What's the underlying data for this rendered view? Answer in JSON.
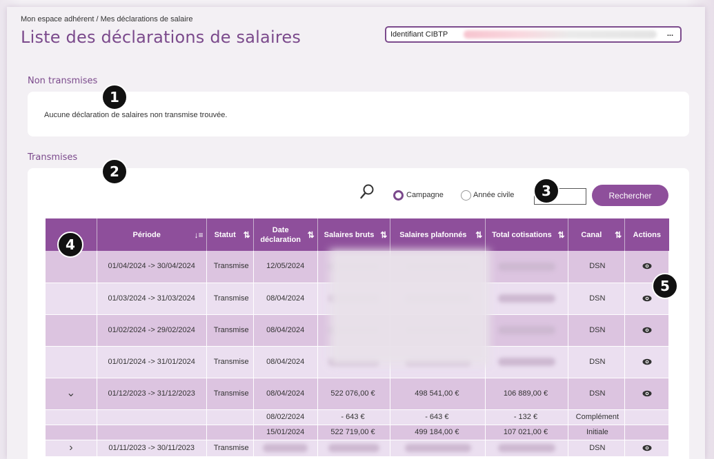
{
  "breadcrumb": "Mon espace adhérent / Mes déclarations de salaire",
  "page_title": "Liste des déclarations de salaires",
  "ident": {
    "label": "Identifiant CIBTP",
    "more": "..."
  },
  "non_transmises": {
    "label": "Non transmises",
    "empty_text": "Aucune déclaration de salaires non transmise trouvée."
  },
  "transmises": {
    "label": "Transmises"
  },
  "search": {
    "radio_campagne": "Campagne",
    "radio_annee": "Année civile",
    "selected": "Campagne",
    "input_value": "",
    "button": "Rechercher"
  },
  "badges": [
    "1",
    "2",
    "3",
    "4",
    "5"
  ],
  "table": {
    "headers": {
      "periode": "Période",
      "statut": "Statut",
      "date_declaration": "Date déclaration",
      "salaires_bruts": "Salaires bruts",
      "salaires_plafonnes": "Salaires plafonnés",
      "total_cotisations": "Total cotisations",
      "canal": "Canal",
      "actions": "Actions"
    },
    "rows": [
      {
        "periode": "01/04/2024 -> 30/04/2024",
        "statut": "Transmise",
        "date": "12/05/2024",
        "canal": "DSN"
      },
      {
        "periode": "01/03/2024 -> 31/03/2024",
        "statut": "Transmise",
        "date": "08/04/2024",
        "canal": "DSN"
      },
      {
        "periode": "01/02/2024 -> 29/02/2024",
        "statut": "Transmise",
        "date": "08/04/2024",
        "canal": "DSN"
      },
      {
        "periode": "01/01/2024 -> 31/01/2024",
        "statut": "Transmise",
        "date": "08/04/2024",
        "canal": "DSN"
      },
      {
        "periode": "01/12/2023 -> 31/12/2023",
        "statut": "Transmise",
        "date": "08/04/2024",
        "bruts": "522 076,00 €",
        "plafonnes": "498 541,00 €",
        "cotisations": "106 889,00 €",
        "canal": "DSN"
      }
    ],
    "sub_rows": [
      {
        "date": "08/02/2024",
        "bruts": "- 643 €",
        "plafonnes": "- 643 €",
        "cotisations": "- 132 €",
        "canal": "Complément"
      },
      {
        "date": "15/01/2024",
        "bruts": "522 719,00 €",
        "plafonnes": "499 184,00 €",
        "cotisations": "107 021,00 €",
        "canal": "Initiale"
      }
    ],
    "last_row": {
      "periode": "01/11/2023 -> 30/11/2023",
      "statut": "Transmise",
      "canal": "DSN"
    }
  },
  "icons": {
    "search": "magnifier-icon",
    "view": "eye-icon",
    "expand": "chevron-right-icon",
    "collapse": "chevron-down-icon"
  },
  "colors": {
    "brand": "#8e4f9b",
    "title": "#7b4a8c",
    "row_dark": "#dcc4e0",
    "row_light": "#ebdff0"
  }
}
